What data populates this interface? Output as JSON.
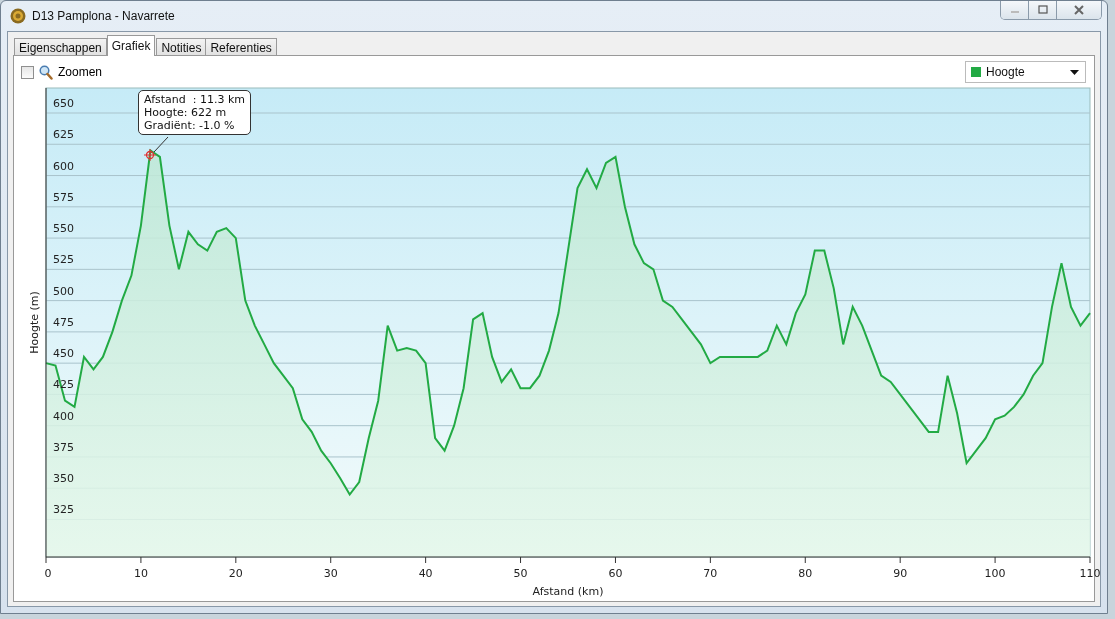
{
  "window": {
    "title": "D13 Pamplona - Navarrete"
  },
  "tabs": [
    {
      "label": "Eigenschappen",
      "selected": false
    },
    {
      "label": "Grafiek",
      "selected": true
    },
    {
      "label": "Notities",
      "selected": false
    },
    {
      "label": "Referenties",
      "selected": false
    }
  ],
  "zoom_checkbox": {
    "label": "Zoomen",
    "checked": false
  },
  "chart": {
    "tooltip": [
      "Afstand  : 11.3 km",
      "Hoogte: 622 m",
      "Gradiënt: -1.0 %"
    ],
    "chart_data": {
      "type": "area",
      "grid": true,
      "xlabel": "Afstand  (km)",
      "ylabel": "Hoogte (m)",
      "xlim": [
        0,
        110
      ],
      "ylim": [
        295,
        670
      ],
      "xticks": [
        0,
        10,
        20,
        30,
        40,
        50,
        60,
        70,
        80,
        90,
        100,
        110
      ],
      "yticks": [
        325,
        350,
        375,
        400,
        425,
        450,
        475,
        500,
        525,
        550,
        575,
        600,
        625,
        650
      ],
      "x": [
        0,
        1,
        2,
        3,
        4,
        5,
        6,
        7,
        8,
        9,
        10,
        11,
        12,
        13,
        14,
        15,
        16,
        17,
        18,
        19,
        20,
        21,
        22,
        23,
        24,
        25,
        26,
        27,
        28,
        29,
        30,
        31,
        32,
        33,
        34,
        35,
        36,
        37,
        38,
        39,
        40,
        41,
        42,
        43,
        44,
        45,
        46,
        47,
        48,
        49,
        50,
        51,
        52,
        53,
        54,
        55,
        56,
        57,
        58,
        59,
        60,
        61,
        62,
        63,
        64,
        65,
        66,
        67,
        68,
        69,
        70,
        71,
        72,
        73,
        74,
        75,
        76,
        77,
        78,
        79,
        80,
        81,
        82,
        83,
        84,
        85,
        86,
        87,
        88,
        89,
        90,
        91,
        92,
        93,
        94,
        95,
        96,
        97,
        98,
        99,
        100,
        101,
        102,
        103,
        104,
        105,
        106,
        107,
        108,
        109,
        110
      ],
      "series": [
        {
          "name": "Hoogte",
          "color": "#22aa44",
          "values": [
            450,
            448,
            420,
            415,
            455,
            445,
            455,
            475,
            500,
            520,
            560,
            620,
            615,
            560,
            525,
            555,
            545,
            540,
            555,
            558,
            550,
            500,
            480,
            465,
            450,
            440,
            430,
            405,
            395,
            380,
            370,
            358,
            345,
            355,
            390,
            420,
            480,
            460,
            462,
            460,
            450,
            390,
            380,
            400,
            430,
            485,
            490,
            455,
            435,
            445,
            430,
            430,
            440,
            460,
            490,
            540,
            590,
            605,
            590,
            610,
            615,
            575,
            545,
            530,
            525,
            500,
            495,
            485,
            475,
            465,
            450,
            455,
            455,
            455,
            455,
            455,
            460,
            480,
            465,
            490,
            505,
            540,
            540,
            510,
            465,
            495,
            480,
            460,
            440,
            435,
            425,
            415,
            405,
            395,
            395,
            440,
            410,
            370,
            380,
            390,
            405,
            408,
            415,
            425,
            440,
            450,
            495,
            530,
            495,
            480,
            490
          ]
        }
      ]
    }
  }
}
